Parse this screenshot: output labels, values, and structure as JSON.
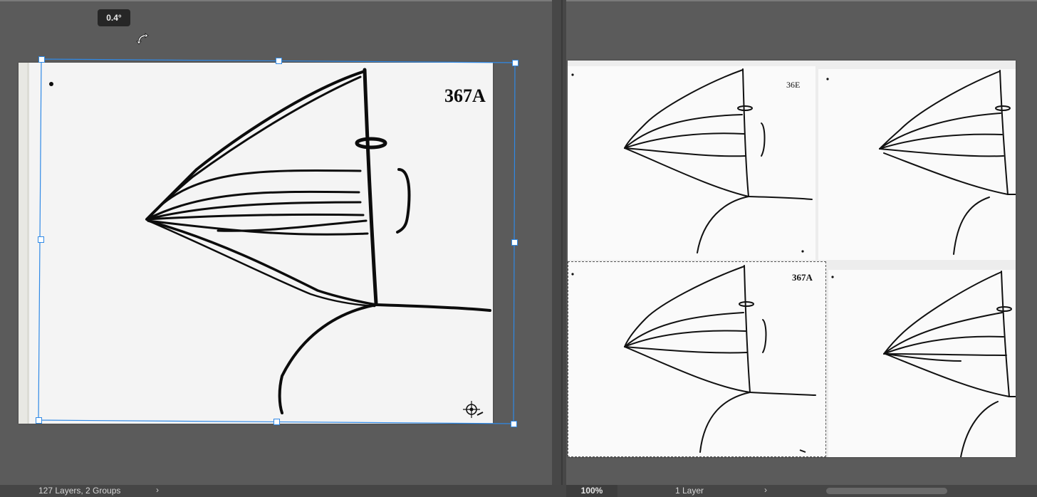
{
  "transform": {
    "rotation_label": "0.4°"
  },
  "left_canvas": {
    "page_note": "367A"
  },
  "right_canvas": {
    "tile_notes": [
      "36E",
      "367A"
    ]
  },
  "statusbar": {
    "layers_info": "127 Layers, 2 Groups",
    "zoom": "100%",
    "layer_count": "1 Layer"
  },
  "colors": {
    "handle_border": "#2f89e6",
    "canvas_bg": "#5b5b5b"
  }
}
